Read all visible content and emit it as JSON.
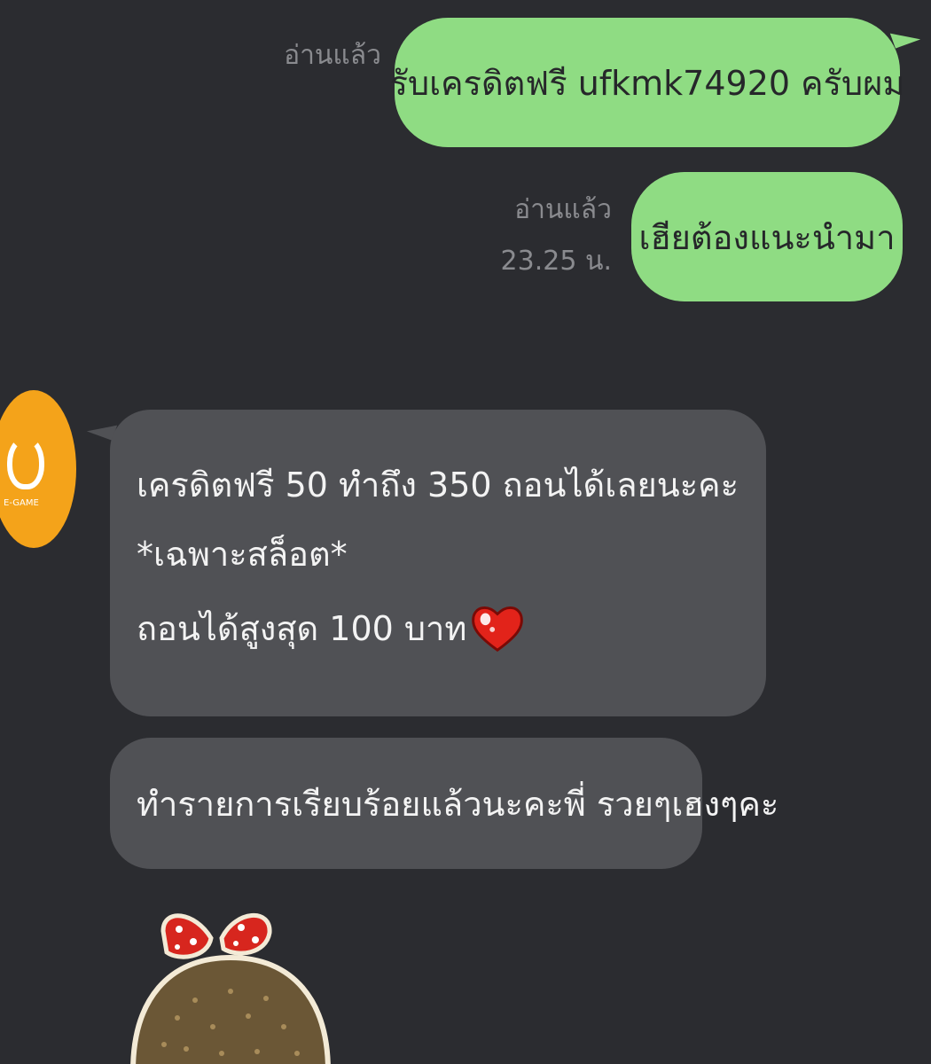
{
  "messages": {
    "out1": {
      "read_status": "อ่านแล้ว",
      "text": "รับเครดิตฟรี ufkmk74920 ครับผม"
    },
    "out2": {
      "read_status": "อ่านแล้ว",
      "time": "23.25 น.",
      "text": "เฮียต้องแนะนำมา"
    },
    "in1": {
      "line1": "เครดิตฟรี 50 ทำถึง 350 ถอนได้เลยนะคะ",
      "line2": "*เฉพาะสล็อต*",
      "line3": "ถอนได้สูงสุด 100 บาท",
      "emoji": "heart-icon"
    },
    "in2": {
      "text": "ทำรายการเรียบร้อยแล้วนะคะพี่ รวยๆเฮงๆคะ"
    }
  },
  "avatar": {
    "label": "E-GAME",
    "color": "#f4a31a"
  },
  "colors": {
    "background": "#2b2c30",
    "outgoing_bubble": "#8fdc83",
    "incoming_bubble": "#505155",
    "meta_text": "#8a8b8f"
  }
}
